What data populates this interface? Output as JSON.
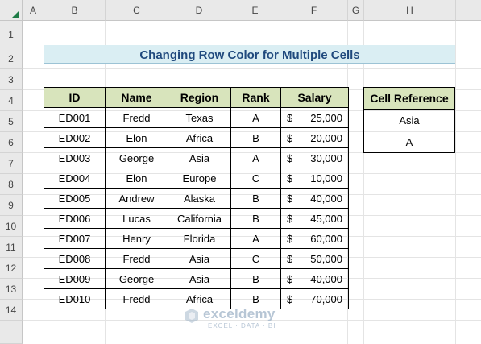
{
  "columns": [
    "A",
    "B",
    "C",
    "D",
    "E",
    "F",
    "G",
    "H"
  ],
  "rows": [
    "1",
    "2",
    "3",
    "4",
    "5",
    "6",
    "7",
    "8",
    "9",
    "10",
    "11",
    "12",
    "13",
    "14"
  ],
  "title": "Changing Row Color for Multiple Cells",
  "table": {
    "headers": [
      "ID",
      "Name",
      "Region",
      "Rank",
      "Salary"
    ],
    "currency_symbol": "$",
    "rows": [
      {
        "id": "ED001",
        "name": "Fredd",
        "region": "Texas",
        "rank": "A",
        "salary": "25,000"
      },
      {
        "id": "ED002",
        "name": "Elon",
        "region": "Africa",
        "rank": "B",
        "salary": "20,000"
      },
      {
        "id": "ED003",
        "name": "George",
        "region": "Asia",
        "rank": "A",
        "salary": "30,000"
      },
      {
        "id": "ED004",
        "name": "Elon",
        "region": "Europe",
        "rank": "C",
        "salary": "10,000"
      },
      {
        "id": "ED005",
        "name": "Andrew",
        "region": "Alaska",
        "rank": "B",
        "salary": "40,000"
      },
      {
        "id": "ED006",
        "name": "Lucas",
        "region": "California",
        "rank": "B",
        "salary": "45,000"
      },
      {
        "id": "ED007",
        "name": "Henry",
        "region": "Florida",
        "rank": "A",
        "salary": "60,000"
      },
      {
        "id": "ED008",
        "name": "Fredd",
        "region": "Asia",
        "rank": "C",
        "salary": "50,000"
      },
      {
        "id": "ED009",
        "name": "George",
        "region": "Asia",
        "rank": "B",
        "salary": "40,000"
      },
      {
        "id": "ED010",
        "name": "Fredd",
        "region": "Africa",
        "rank": "B",
        "salary": "70,000"
      }
    ]
  },
  "reference": {
    "header": "Cell Reference",
    "values": [
      "Asia",
      "A"
    ]
  },
  "watermark": {
    "name": "exceldemy",
    "tagline": "EXCEL · DATA · BI"
  },
  "colors": {
    "header_fill": "#d8e4bc",
    "title_fill": "#daeef3",
    "title_text": "#1f497d",
    "select_all_triangle": "#1e7b46"
  }
}
